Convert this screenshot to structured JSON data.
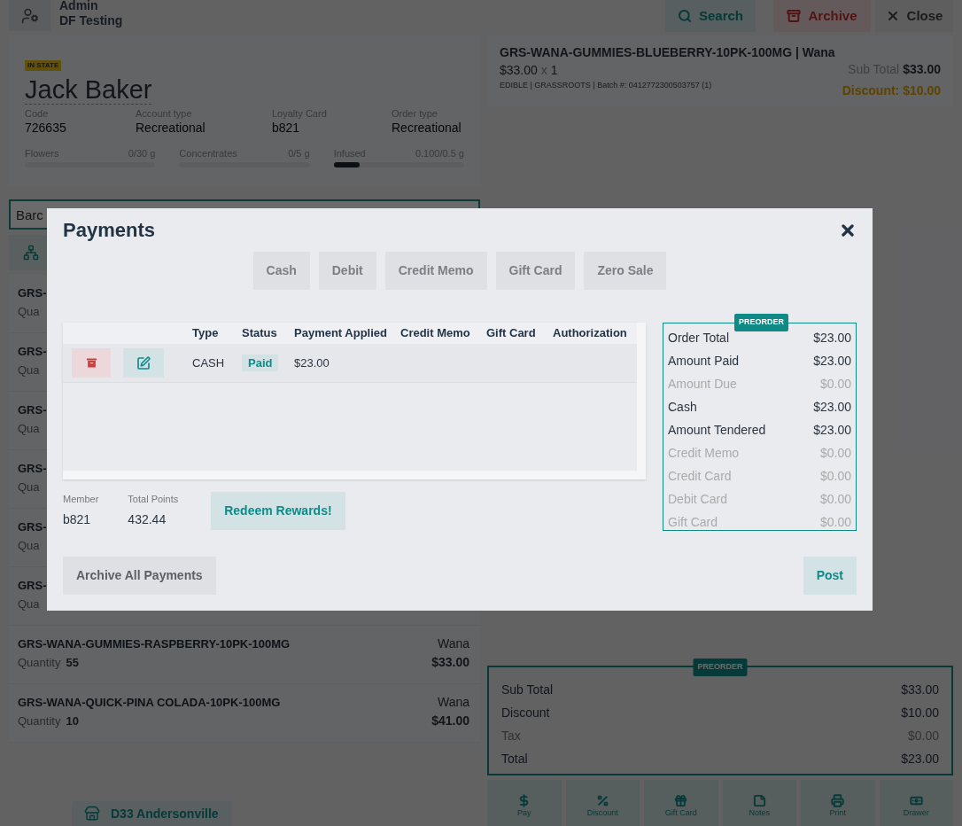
{
  "header": {
    "user_name": "Admin",
    "store_name": "DF Testing",
    "buttons": [
      {
        "kind": "search",
        "label": "Search"
      },
      {
        "kind": "archive",
        "label": "Archive"
      },
      {
        "kind": "close",
        "label": "Close"
      }
    ]
  },
  "customer": {
    "badge": "IN STATE",
    "name": "Jack Baker",
    "fields": [
      {
        "label": "Code",
        "value": "726635"
      },
      {
        "label": "Account type",
        "value": "Recreational"
      },
      {
        "label": "Loyalty Card",
        "value": "b821"
      },
      {
        "label": "Order type",
        "value": "Recreational"
      }
    ],
    "limits": [
      {
        "label": "Flowers",
        "reading": "0/30 g",
        "level": 0
      },
      {
        "label": "Concentrates",
        "reading": "0/5 g",
        "level": 0
      },
      {
        "label": "Infused",
        "reading": "0.100/0.5 g",
        "level": 0.2
      }
    ]
  },
  "search": {
    "placeholder": "Barc"
  },
  "products": [
    {
      "name": "GRS-",
      "quantity_label": "Qua"
    },
    {
      "name": "GRS-",
      "quantity_label": "Qua"
    },
    {
      "name": "GRS-",
      "quantity_label": "Qua"
    },
    {
      "name": "GRS-",
      "quantity_label": "Qua"
    },
    {
      "name": "GRS-",
      "quantity_label": "Qua"
    },
    {
      "name": "GRS-",
      "quantity_label": "Qua"
    },
    {
      "name": "GRS-WANA-GUMMIES-RASPBERRY-10PK-100MG",
      "quantity_label": "Quantity",
      "quantity": "55",
      "brand": "Wana",
      "price": "$33.00"
    },
    {
      "name": "GRS-WANA-QUICK-PINA COLADA-10PK-100MG",
      "quantity_label": "Quantity",
      "quantity": "10",
      "brand": "Wana",
      "price": "$41.00"
    }
  ],
  "store": "D33 Andersonville",
  "cart_item": {
    "title": "GRS-WANA-GUMMIES-BLUEBERRY-10PK-100MG | Wana",
    "price": "$33.00",
    "times": "x",
    "qty": "1",
    "details": "EDIBLE | GRASSROOTS | Batch #: 0412772300503757 (1)",
    "subtotal_label": "Sub Total",
    "subtotal": "$33.00",
    "discount": "Discount: $10.00"
  },
  "totals": {
    "badge": "PREORDER",
    "rows": [
      {
        "label": "Sub Total",
        "value": "$33.00",
        "muted": false
      },
      {
        "label": "Discount",
        "value": "$10.00",
        "muted": false
      },
      {
        "label": "Tax",
        "value": "$0.00",
        "muted": true
      },
      {
        "label": "Total",
        "value": "$23.00",
        "muted": false
      }
    ]
  },
  "actions": [
    "Pay",
    "Discount",
    "Gift Card",
    "Notes",
    "Print",
    "Drawer"
  ],
  "modal": {
    "title": "Payments",
    "methods": [
      "Cash",
      "Debit",
      "Credit Memo",
      "Gift Card",
      "Zero Sale"
    ],
    "table": {
      "columns": [
        "Type",
        "Status",
        "Payment Applied",
        "Credit Memo",
        "Gift Card",
        "Authorization"
      ],
      "rows": [
        {
          "type": "CASH",
          "status": "Paid",
          "payment_applied": "$23.00"
        }
      ]
    },
    "member": {
      "label": "Member",
      "value": "b821"
    },
    "points": {
      "label": "Total Points",
      "value": "432.44"
    },
    "redeem": "Redeem Rewards!",
    "summary": {
      "badge": "PREORDER",
      "rows": [
        {
          "label": "Order Total",
          "value": "$23.00",
          "muted": false
        },
        {
          "label": "Amount Paid",
          "value": "$23.00",
          "muted": false
        },
        {
          "label": "Amount Due",
          "value": "$0.00",
          "muted": true
        },
        {
          "label": "Cash",
          "value": "$23.00",
          "muted": false
        },
        {
          "label": "Amount Tendered",
          "value": "$23.00",
          "muted": false
        },
        {
          "label": "Credit Memo",
          "value": "$0.00",
          "muted": true
        },
        {
          "label": "Credit Card",
          "value": "$0.00",
          "muted": true
        },
        {
          "label": "Debit Card",
          "value": "$0.00",
          "muted": true
        },
        {
          "label": "Gift Card",
          "value": "$0.00",
          "muted": true
        }
      ]
    },
    "archive_all": "Archive All Payments",
    "post": "Post"
  }
}
